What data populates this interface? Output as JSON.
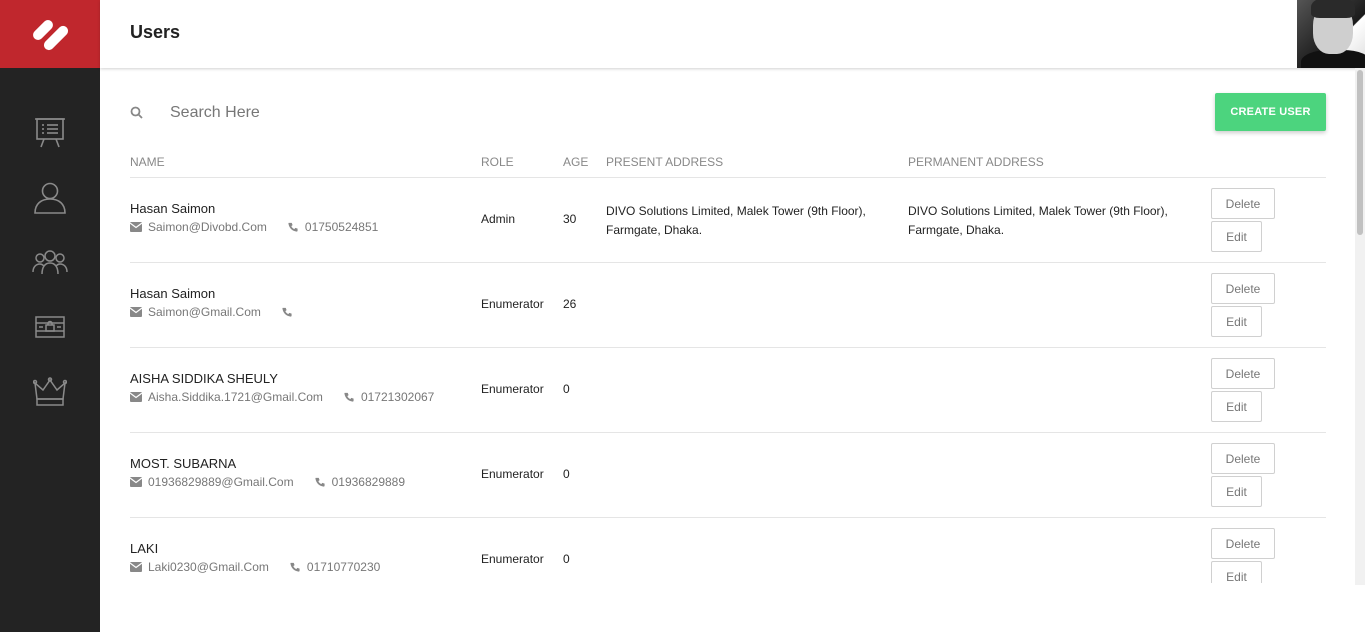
{
  "header": {
    "title": "Users"
  },
  "sidebar": {
    "items": [
      {
        "icon": "presentation-board-icon",
        "label": ""
      },
      {
        "icon": "user-icon",
        "label": ""
      },
      {
        "icon": "users-group-icon",
        "label": ""
      },
      {
        "icon": "cash-register-icon",
        "label": ""
      },
      {
        "icon": "crown-icon",
        "label": ""
      }
    ]
  },
  "search": {
    "placeholder": "Search Here",
    "value": ""
  },
  "actions": {
    "create_user": "CREATE USER"
  },
  "colors": {
    "brand": "#c0272d",
    "sidebar": "#232323",
    "accent": "#4cd47e"
  },
  "table": {
    "columns": {
      "name": "NAME",
      "role": "ROLE",
      "age": "AGE",
      "present_address": "PRESENT ADDRESS",
      "permanent_address": "PERMANENT ADDRESS"
    },
    "rows": [
      {
        "name": "Hasan Saimon",
        "email": "Saimon@Divobd.Com",
        "phone": "01750524851",
        "role": "Admin",
        "age": "30",
        "present_address": "DIVO Solutions Limited, Malek Tower (9th Floor), Farmgate, Dhaka.",
        "permanent_address": "DIVO Solutions Limited, Malek Tower (9th Floor), Farmgate, Dhaka.",
        "delete": "Delete",
        "edit": "Edit"
      },
      {
        "name": "Hasan Saimon",
        "email": "Saimon@Gmail.Com",
        "phone": "",
        "role": "Enumerator",
        "age": "26",
        "present_address": "",
        "permanent_address": "",
        "delete": "Delete",
        "edit": "Edit"
      },
      {
        "name": "AISHA SIDDIKA SHEULY",
        "email": "Aisha.Siddika.1721@Gmail.Com",
        "phone": "01721302067",
        "role": "Enumerator",
        "age": "0",
        "present_address": "",
        "permanent_address": "",
        "delete": "Delete",
        "edit": "Edit"
      },
      {
        "name": "MOST. SUBARNA",
        "email": "01936829889@Gmail.Com",
        "phone": "01936829889",
        "role": "Enumerator",
        "age": "0",
        "present_address": "",
        "permanent_address": "",
        "delete": "Delete",
        "edit": "Edit"
      },
      {
        "name": "LAKI",
        "email": "Laki0230@Gmail.Com",
        "phone": "01710770230",
        "role": "Enumerator",
        "age": "0",
        "present_address": "",
        "permanent_address": "",
        "delete": "Delete",
        "edit": "Edit"
      }
    ]
  }
}
